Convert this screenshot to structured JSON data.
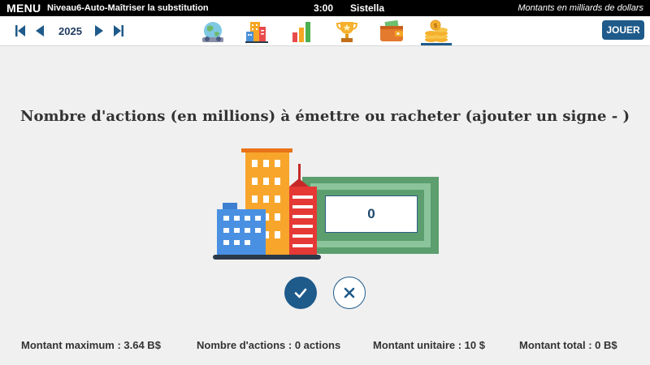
{
  "topbar": {
    "menu_label": "MENU",
    "level": "Niveau6-Auto-Maîtriser la substitution",
    "time": "3:00",
    "company": "Sistella",
    "units": "Montants en milliards de dollars"
  },
  "toolbar": {
    "year": "2025",
    "play_label": "JOUER",
    "nav_icons": [
      "globe-icon",
      "buildings-icon",
      "bar-chart-icon",
      "trophy-icon",
      "wallet-icon",
      "coins-icon"
    ],
    "active_icon": "coins-icon"
  },
  "main": {
    "question": "Nombre d'actions (en millions) à émettre ou racheter (ajouter un signe - )",
    "input_value": "0"
  },
  "footer": {
    "max_amount": "Montant maximum : 3.64 B$",
    "share_count": "Nombre d'actions : 0 actions",
    "unit_amount": "Montant unitaire : 10 $",
    "total_amount": "Montant total : 0 B$"
  },
  "colors": {
    "accent": "#1e5a8a",
    "topbar": "#000000",
    "background": "#f0f0f0",
    "money_green": "#5c9e6e"
  }
}
